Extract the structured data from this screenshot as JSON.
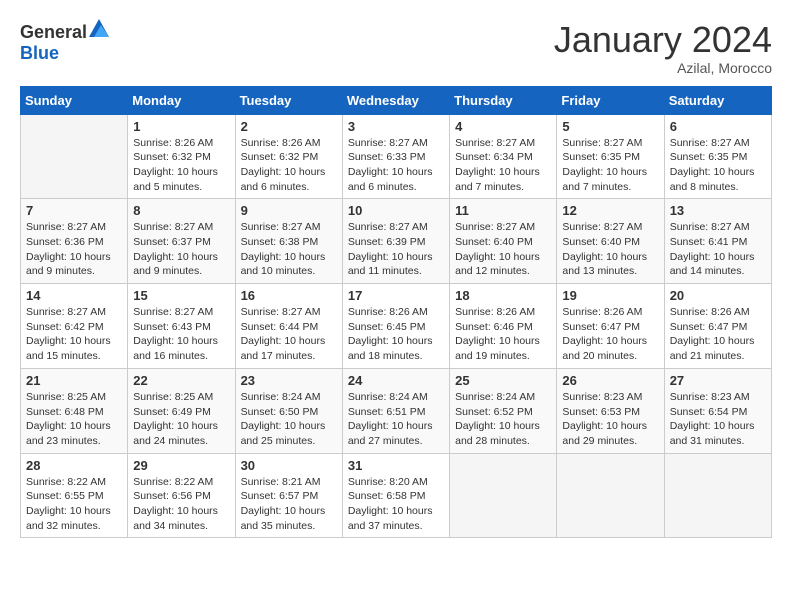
{
  "header": {
    "logo_general": "General",
    "logo_blue": "Blue",
    "month_title": "January 2024",
    "location": "Azilal, Morocco"
  },
  "days_of_week": [
    "Sunday",
    "Monday",
    "Tuesday",
    "Wednesday",
    "Thursday",
    "Friday",
    "Saturday"
  ],
  "weeks": [
    [
      {
        "day": "",
        "info": ""
      },
      {
        "day": "1",
        "info": "Sunrise: 8:26 AM\nSunset: 6:32 PM\nDaylight: 10 hours\nand 5 minutes."
      },
      {
        "day": "2",
        "info": "Sunrise: 8:26 AM\nSunset: 6:32 PM\nDaylight: 10 hours\nand 6 minutes."
      },
      {
        "day": "3",
        "info": "Sunrise: 8:27 AM\nSunset: 6:33 PM\nDaylight: 10 hours\nand 6 minutes."
      },
      {
        "day": "4",
        "info": "Sunrise: 8:27 AM\nSunset: 6:34 PM\nDaylight: 10 hours\nand 7 minutes."
      },
      {
        "day": "5",
        "info": "Sunrise: 8:27 AM\nSunset: 6:35 PM\nDaylight: 10 hours\nand 7 minutes."
      },
      {
        "day": "6",
        "info": "Sunrise: 8:27 AM\nSunset: 6:35 PM\nDaylight: 10 hours\nand 8 minutes."
      }
    ],
    [
      {
        "day": "7",
        "info": "Sunrise: 8:27 AM\nSunset: 6:36 PM\nDaylight: 10 hours\nand 9 minutes."
      },
      {
        "day": "8",
        "info": "Sunrise: 8:27 AM\nSunset: 6:37 PM\nDaylight: 10 hours\nand 9 minutes."
      },
      {
        "day": "9",
        "info": "Sunrise: 8:27 AM\nSunset: 6:38 PM\nDaylight: 10 hours\nand 10 minutes."
      },
      {
        "day": "10",
        "info": "Sunrise: 8:27 AM\nSunset: 6:39 PM\nDaylight: 10 hours\nand 11 minutes."
      },
      {
        "day": "11",
        "info": "Sunrise: 8:27 AM\nSunset: 6:40 PM\nDaylight: 10 hours\nand 12 minutes."
      },
      {
        "day": "12",
        "info": "Sunrise: 8:27 AM\nSunset: 6:40 PM\nDaylight: 10 hours\nand 13 minutes."
      },
      {
        "day": "13",
        "info": "Sunrise: 8:27 AM\nSunset: 6:41 PM\nDaylight: 10 hours\nand 14 minutes."
      }
    ],
    [
      {
        "day": "14",
        "info": "Sunrise: 8:27 AM\nSunset: 6:42 PM\nDaylight: 10 hours\nand 15 minutes."
      },
      {
        "day": "15",
        "info": "Sunrise: 8:27 AM\nSunset: 6:43 PM\nDaylight: 10 hours\nand 16 minutes."
      },
      {
        "day": "16",
        "info": "Sunrise: 8:27 AM\nSunset: 6:44 PM\nDaylight: 10 hours\nand 17 minutes."
      },
      {
        "day": "17",
        "info": "Sunrise: 8:26 AM\nSunset: 6:45 PM\nDaylight: 10 hours\nand 18 minutes."
      },
      {
        "day": "18",
        "info": "Sunrise: 8:26 AM\nSunset: 6:46 PM\nDaylight: 10 hours\nand 19 minutes."
      },
      {
        "day": "19",
        "info": "Sunrise: 8:26 AM\nSunset: 6:47 PM\nDaylight: 10 hours\nand 20 minutes."
      },
      {
        "day": "20",
        "info": "Sunrise: 8:26 AM\nSunset: 6:47 PM\nDaylight: 10 hours\nand 21 minutes."
      }
    ],
    [
      {
        "day": "21",
        "info": "Sunrise: 8:25 AM\nSunset: 6:48 PM\nDaylight: 10 hours\nand 23 minutes."
      },
      {
        "day": "22",
        "info": "Sunrise: 8:25 AM\nSunset: 6:49 PM\nDaylight: 10 hours\nand 24 minutes."
      },
      {
        "day": "23",
        "info": "Sunrise: 8:24 AM\nSunset: 6:50 PM\nDaylight: 10 hours\nand 25 minutes."
      },
      {
        "day": "24",
        "info": "Sunrise: 8:24 AM\nSunset: 6:51 PM\nDaylight: 10 hours\nand 27 minutes."
      },
      {
        "day": "25",
        "info": "Sunrise: 8:24 AM\nSunset: 6:52 PM\nDaylight: 10 hours\nand 28 minutes."
      },
      {
        "day": "26",
        "info": "Sunrise: 8:23 AM\nSunset: 6:53 PM\nDaylight: 10 hours\nand 29 minutes."
      },
      {
        "day": "27",
        "info": "Sunrise: 8:23 AM\nSunset: 6:54 PM\nDaylight: 10 hours\nand 31 minutes."
      }
    ],
    [
      {
        "day": "28",
        "info": "Sunrise: 8:22 AM\nSunset: 6:55 PM\nDaylight: 10 hours\nand 32 minutes."
      },
      {
        "day": "29",
        "info": "Sunrise: 8:22 AM\nSunset: 6:56 PM\nDaylight: 10 hours\nand 34 minutes."
      },
      {
        "day": "30",
        "info": "Sunrise: 8:21 AM\nSunset: 6:57 PM\nDaylight: 10 hours\nand 35 minutes."
      },
      {
        "day": "31",
        "info": "Sunrise: 8:20 AM\nSunset: 6:58 PM\nDaylight: 10 hours\nand 37 minutes."
      },
      {
        "day": "",
        "info": ""
      },
      {
        "day": "",
        "info": ""
      },
      {
        "day": "",
        "info": ""
      }
    ]
  ]
}
